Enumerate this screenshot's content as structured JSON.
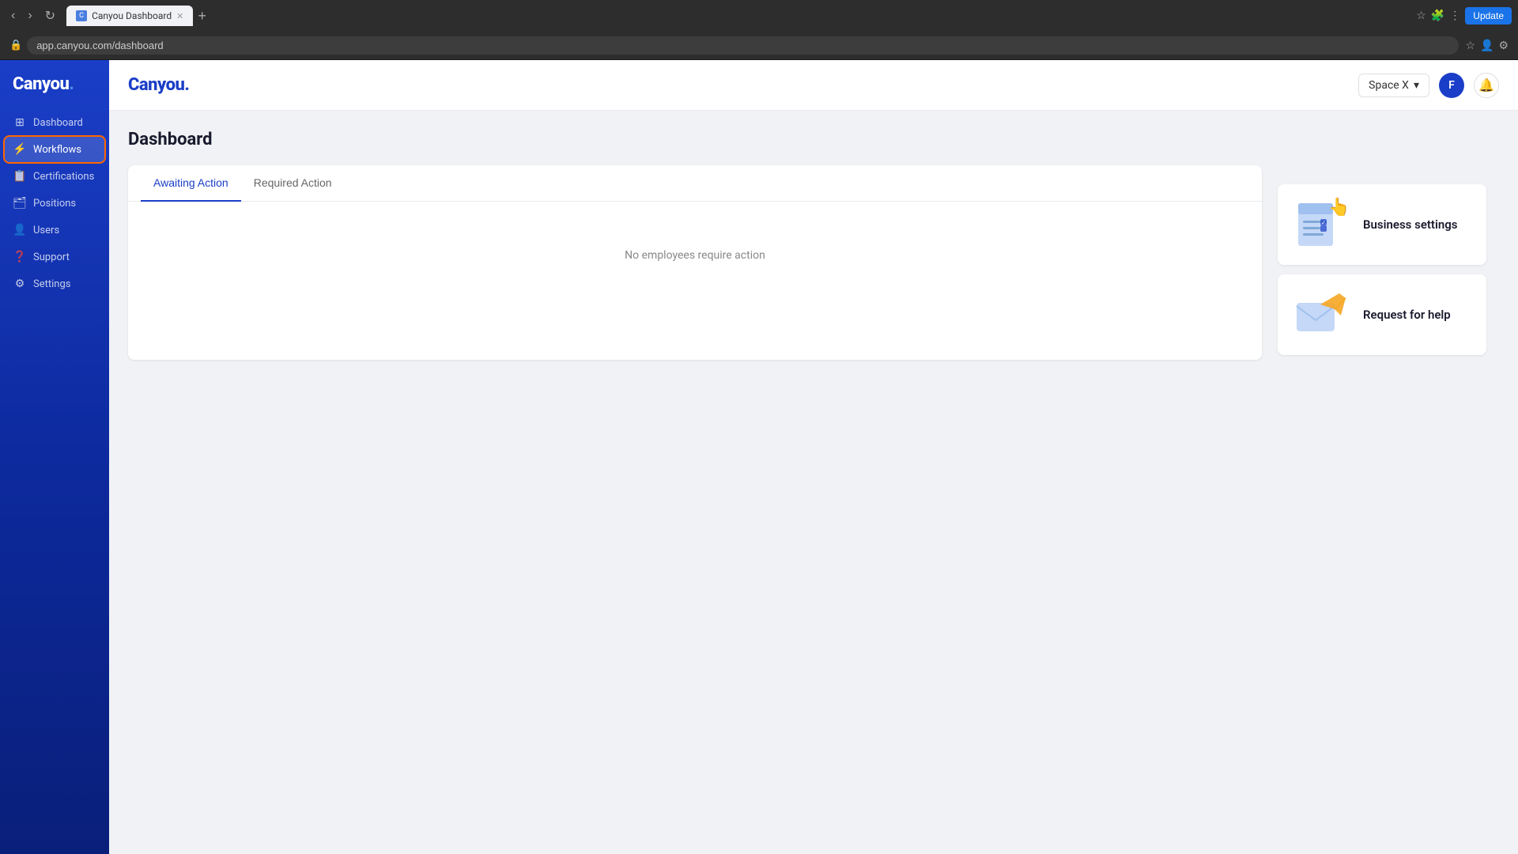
{
  "browser": {
    "tab_title": "Canyou Dashboard",
    "new_tab_label": "+",
    "address": "app.canyou.com/dashboard",
    "update_btn": "Update"
  },
  "header": {
    "logo": "Canyou.",
    "space_selector": "Space X",
    "chevron": "▾",
    "avatar_initials": "F",
    "notification_icon": "🔔"
  },
  "sidebar": {
    "items": [
      {
        "id": "dashboard",
        "label": "Dashboard",
        "icon": "⊞"
      },
      {
        "id": "workflows",
        "label": "Workflows",
        "icon": "⚡"
      },
      {
        "id": "certifications",
        "label": "Certifications",
        "icon": "📋"
      },
      {
        "id": "positions",
        "label": "Positions",
        "icon": "🗂"
      },
      {
        "id": "users",
        "label": "Users",
        "icon": "👤"
      },
      {
        "id": "support",
        "label": "Support",
        "icon": "❓"
      },
      {
        "id": "settings",
        "label": "Settings",
        "icon": "⚙"
      }
    ]
  },
  "page": {
    "title": "Dashboard",
    "tabs": [
      {
        "id": "awaiting",
        "label": "Awaiting Action",
        "active": true
      },
      {
        "id": "required",
        "label": "Required Action",
        "active": false
      }
    ],
    "empty_message": "No employees require action"
  },
  "right_panel": {
    "cards": [
      {
        "id": "business-settings",
        "title": "Business settings"
      },
      {
        "id": "request-help",
        "title": "Request for help"
      }
    ]
  }
}
